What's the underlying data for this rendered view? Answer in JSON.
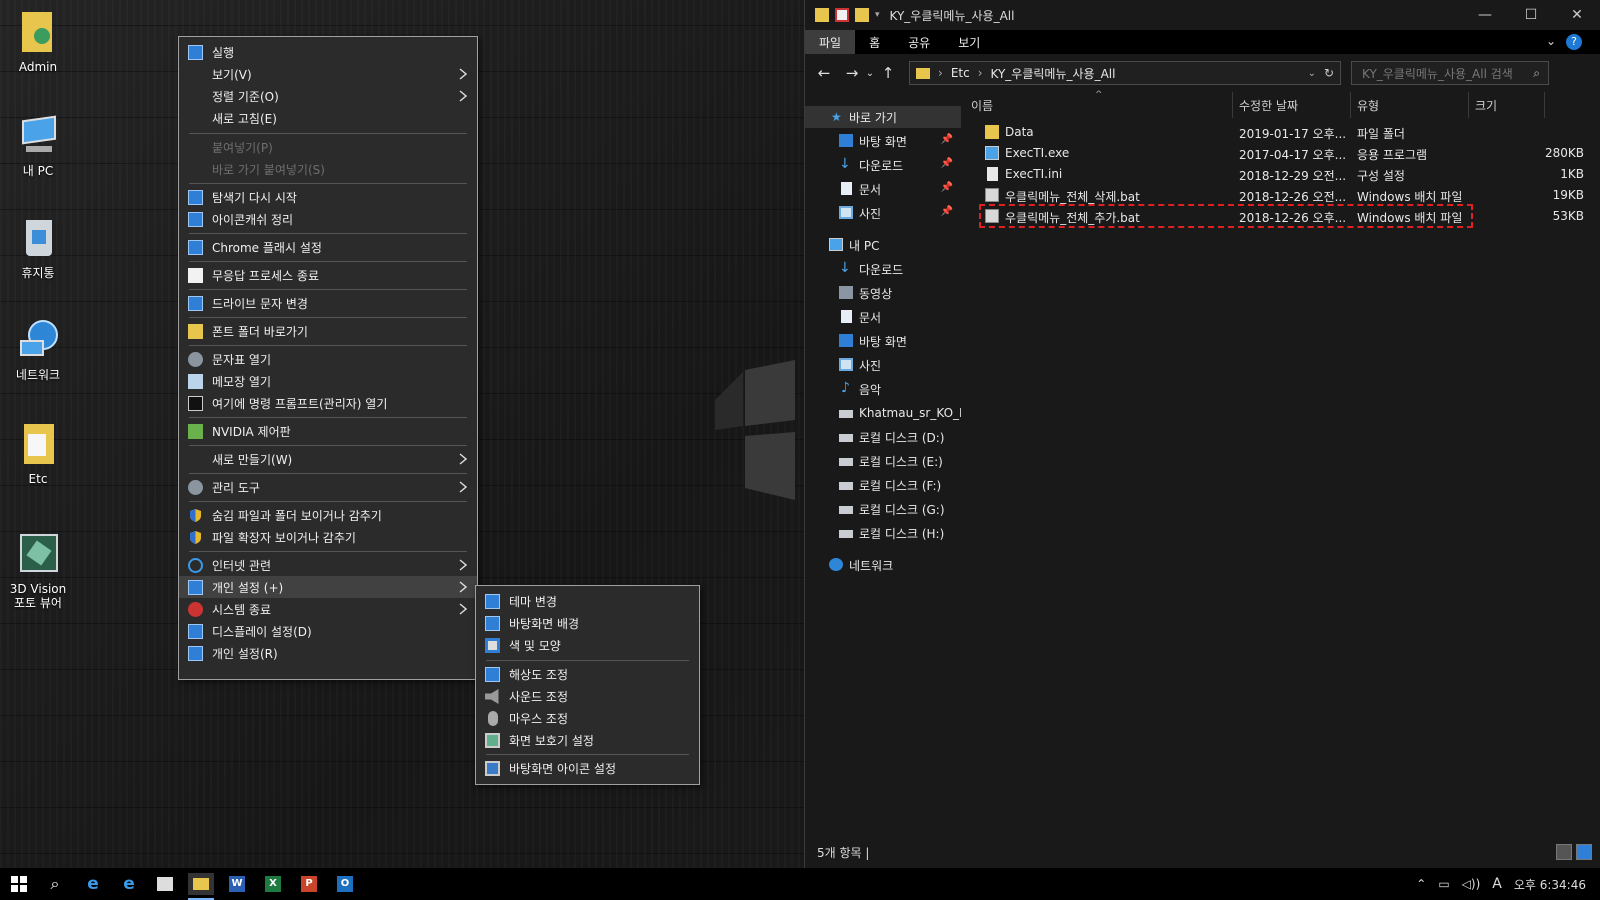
{
  "desktop": {
    "icons": [
      {
        "label": "Admin",
        "icon": "user-folder-icon"
      },
      {
        "label": "내 PC",
        "icon": "computer-icon"
      },
      {
        "label": "휴지통",
        "icon": "recycle-bin-icon"
      },
      {
        "label": "네트워크",
        "icon": "network-icon"
      },
      {
        "label": "Etc",
        "icon": "folder-icon"
      },
      {
        "label": "3D Vision\n포토 뷰어",
        "icon": "photo-viewer-icon"
      }
    ]
  },
  "context_menu": {
    "items": [
      {
        "label": "실행",
        "icon": "run-icon"
      },
      {
        "label": "보기(V)",
        "submenu": true
      },
      {
        "label": "정렬 기준(O)",
        "submenu": true
      },
      {
        "label": "새로 고침(E)"
      },
      {
        "label": "붙여넣기(P)",
        "disabled": true
      },
      {
        "label": "바로 가기 붙여넣기(S)",
        "disabled": true
      },
      {
        "label": "탐색기 다시 시작",
        "icon": "explorer-restart-icon"
      },
      {
        "label": "아이콘캐쉬 정리",
        "icon": "icon-cache-icon"
      },
      {
        "label": "Chrome 플래시 설정",
        "icon": "chrome-flash-icon"
      },
      {
        "label": "무응답 프로세스 종료",
        "icon": "document-icon"
      },
      {
        "label": "드라이브 문자 변경",
        "icon": "drive-letter-icon"
      },
      {
        "label": "폰트 폴더 바로가기",
        "icon": "font-folder-icon"
      },
      {
        "label": "문자표 열기",
        "icon": "charmap-icon"
      },
      {
        "label": "메모장 열기",
        "icon": "notepad-icon"
      },
      {
        "label": "여기에 명령 프롬프트(관리자) 열기",
        "icon": "cmd-icon"
      },
      {
        "label": "NVIDIA 제어판",
        "icon": "nvidia-icon"
      },
      {
        "label": "새로 만들기(W)",
        "submenu": true
      },
      {
        "label": "관리 도구",
        "icon": "gear-icon",
        "submenu": true
      },
      {
        "label": "숨김 파일과 폴더 보이거나 감추기",
        "icon": "shield-icon"
      },
      {
        "label": "파일 확장자 보이거나 감추기",
        "icon": "shield-icon"
      },
      {
        "label": "인터넷 관련",
        "icon": "ie-icon",
        "submenu": true
      },
      {
        "label": "개인 설정 (+)",
        "icon": "personalize-icon",
        "submenu": true,
        "highlighted": true
      },
      {
        "label": "시스템 종료",
        "icon": "power-icon",
        "submenu": true
      },
      {
        "label": "디스플레이 설정(D)",
        "icon": "display-icon"
      },
      {
        "label": "개인 설정(R)",
        "icon": "personalize-icon"
      }
    ]
  },
  "submenu": {
    "items": [
      {
        "label": "테마 변경",
        "icon": "theme-icon"
      },
      {
        "label": "바탕화면 배경",
        "icon": "wallpaper-icon"
      },
      {
        "label": "색 및 모양",
        "icon": "color-icon"
      },
      {
        "label": "해상도 조정",
        "icon": "resolution-icon"
      },
      {
        "label": "사운드 조정",
        "icon": "speaker-icon"
      },
      {
        "label": "마우스 조정",
        "icon": "mouse-icon"
      },
      {
        "label": "화면 보호기 설정",
        "icon": "screensaver-icon"
      },
      {
        "label": "바탕화면 아이콘 설정",
        "icon": "desktop-icons-icon"
      }
    ]
  },
  "explorer": {
    "title": "KY_우클릭메뉴_사용_All",
    "window_controls": {
      "minimize": "—",
      "maximize": "☐",
      "close": "✕"
    },
    "ribbon_tabs": [
      "파일",
      "홈",
      "공유",
      "보기"
    ],
    "address": {
      "segments": [
        "Etc",
        "KY_우클릭메뉴_사용_All"
      ],
      "separator": "›"
    },
    "search_placeholder": "KY_우클릭메뉴_사용_All 검색",
    "nav": [
      {
        "label": "바로 가기",
        "icon": "star-icon",
        "level": 0,
        "selected": true
      },
      {
        "label": "바탕 화면",
        "icon": "desktop-icon",
        "level": 1,
        "pinned": true
      },
      {
        "label": "다운로드",
        "icon": "download-icon",
        "level": 1,
        "pinned": true
      },
      {
        "label": "문서",
        "icon": "document-icon",
        "level": 1,
        "pinned": true
      },
      {
        "label": "사진",
        "icon": "pictures-icon",
        "level": 1,
        "pinned": true
      },
      {
        "label": "내 PC",
        "icon": "computer-icon",
        "level": 0
      },
      {
        "label": "다운로드",
        "icon": "download-icon",
        "level": 1
      },
      {
        "label": "동영상",
        "icon": "video-icon",
        "level": 1
      },
      {
        "label": "문서",
        "icon": "document-icon",
        "level": 1
      },
      {
        "label": "바탕 화면",
        "icon": "desktop-icon",
        "level": 1
      },
      {
        "label": "사진",
        "icon": "pictures-icon",
        "level": 1
      },
      {
        "label": "음악",
        "icon": "music-icon",
        "level": 1
      },
      {
        "label": "Khatmau_sr_KO_KY",
        "icon": "drive-icon",
        "level": 1
      },
      {
        "label": "로컬 디스크 (D:)",
        "icon": "drive-icon",
        "level": 1
      },
      {
        "label": "로컬 디스크 (E:)",
        "icon": "drive-icon",
        "level": 1
      },
      {
        "label": "로컬 디스크 (F:)",
        "icon": "drive-icon",
        "level": 1
      },
      {
        "label": "로컬 디스크 (G:)",
        "icon": "drive-icon",
        "level": 1
      },
      {
        "label": "로컬 디스크 (H:)",
        "icon": "drive-icon",
        "level": 1
      },
      {
        "label": "네트워크",
        "icon": "network-icon",
        "level": 0
      }
    ],
    "columns": [
      "이름",
      "수정한 날짜",
      "유형",
      "크기"
    ],
    "files": [
      {
        "name": "Data",
        "date": "2019-01-17 오후...",
        "type": "파일 폴더",
        "size": "",
        "icon": "folder-icon"
      },
      {
        "name": "ExecTI.exe",
        "date": "2017-04-17 오후...",
        "type": "응용 프로그램",
        "size": "280KB",
        "icon": "exe-icon"
      },
      {
        "name": "ExecTI.ini",
        "date": "2018-12-29 오전...",
        "type": "구성 설정",
        "size": "1KB",
        "icon": "ini-icon"
      },
      {
        "name": "우클릭메뉴_전체_삭제.bat",
        "date": "2018-12-26 오전...",
        "type": "Windows 배치 파일",
        "size": "19KB",
        "icon": "bat-icon"
      },
      {
        "name": "우클릭메뉴_전체_추가.bat",
        "date": "2018-12-26 오후...",
        "type": "Windows 배치 파일",
        "size": "53KB",
        "icon": "bat-icon",
        "highlighted": true
      }
    ],
    "status": "5개 항목  |"
  },
  "taskbar": {
    "apps": [
      "start-icon",
      "search-icon",
      "ie-icon",
      "edge-icon",
      "store-icon",
      "file-explorer-icon",
      "word-icon",
      "excel-icon",
      "powerpoint-icon",
      "outlook-icon"
    ],
    "clock": "오후 6:34:46",
    "ime": "A"
  },
  "colors": {
    "accent": "#1e78d4",
    "highlight_box": "#e02020",
    "menu_bg": "#2b2b2b"
  }
}
